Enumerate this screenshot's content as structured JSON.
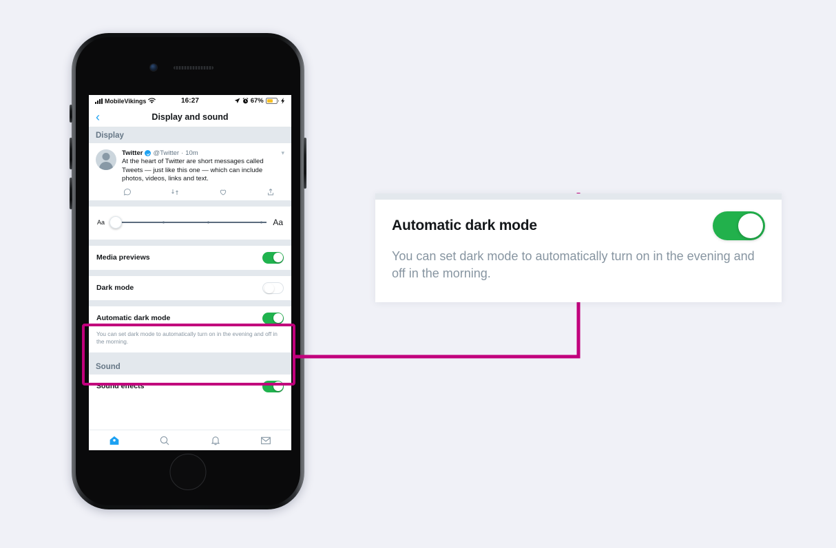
{
  "phone": {
    "status_bar": {
      "carrier": "MobileVikings",
      "wifi_icon": "wifi-icon",
      "time": "16:27",
      "location_icon": "location-arrow-icon",
      "alarm_icon": "alarm-clock-icon",
      "battery_percent": "67%",
      "battery_icon": "battery-low-power-icon",
      "charging_icon": "lightning-bolt-icon"
    },
    "nav": {
      "back_icon": "chevron-left-icon",
      "title": "Display and sound"
    },
    "sections": {
      "display_header": "Display",
      "sound_header": "Sound"
    },
    "tweet_preview": {
      "display_name": "Twitter",
      "verified_icon": "verified-badge-icon",
      "handle": "@Twitter",
      "separator": "·",
      "timestamp": "10m",
      "caret_icon": "chevron-down-icon",
      "text": "At the heart of Twitter are short messages called Tweets — just like this one — which can include photos, videos, links and text.",
      "actions": [
        "reply-icon",
        "retweet-icon",
        "like-icon",
        "share-icon"
      ]
    },
    "font_slider": {
      "min_label": "Aa",
      "max_label": "Aa",
      "value": 0,
      "ticks": 3
    },
    "settings": [
      {
        "label": "Media previews",
        "toggle": "on"
      },
      {
        "label": "Dark mode",
        "toggle": "off"
      },
      {
        "label": "Automatic dark mode",
        "toggle": "on",
        "description": "You can set dark mode to automatically turn on in the evening and off in the morning."
      },
      {
        "label": "Sound effects",
        "toggle": "on"
      }
    ],
    "tab_bar": [
      {
        "icon": "home-icon",
        "active": true
      },
      {
        "icon": "search-icon",
        "active": false
      },
      {
        "icon": "notifications-bell-icon",
        "active": false
      },
      {
        "icon": "messages-envelope-icon",
        "active": false
      }
    ]
  },
  "callout": {
    "title": "Automatic dark mode",
    "description": "You can set dark mode to automatically turn on in the evening and off in the morning.",
    "toggle": "on"
  },
  "colors": {
    "highlight": "#c1007c",
    "toggle_on": "#22b14c",
    "twitter_blue": "#1da1f2",
    "page_background": "#f0f1f7",
    "section_header_bg": "#e3e8ed"
  }
}
